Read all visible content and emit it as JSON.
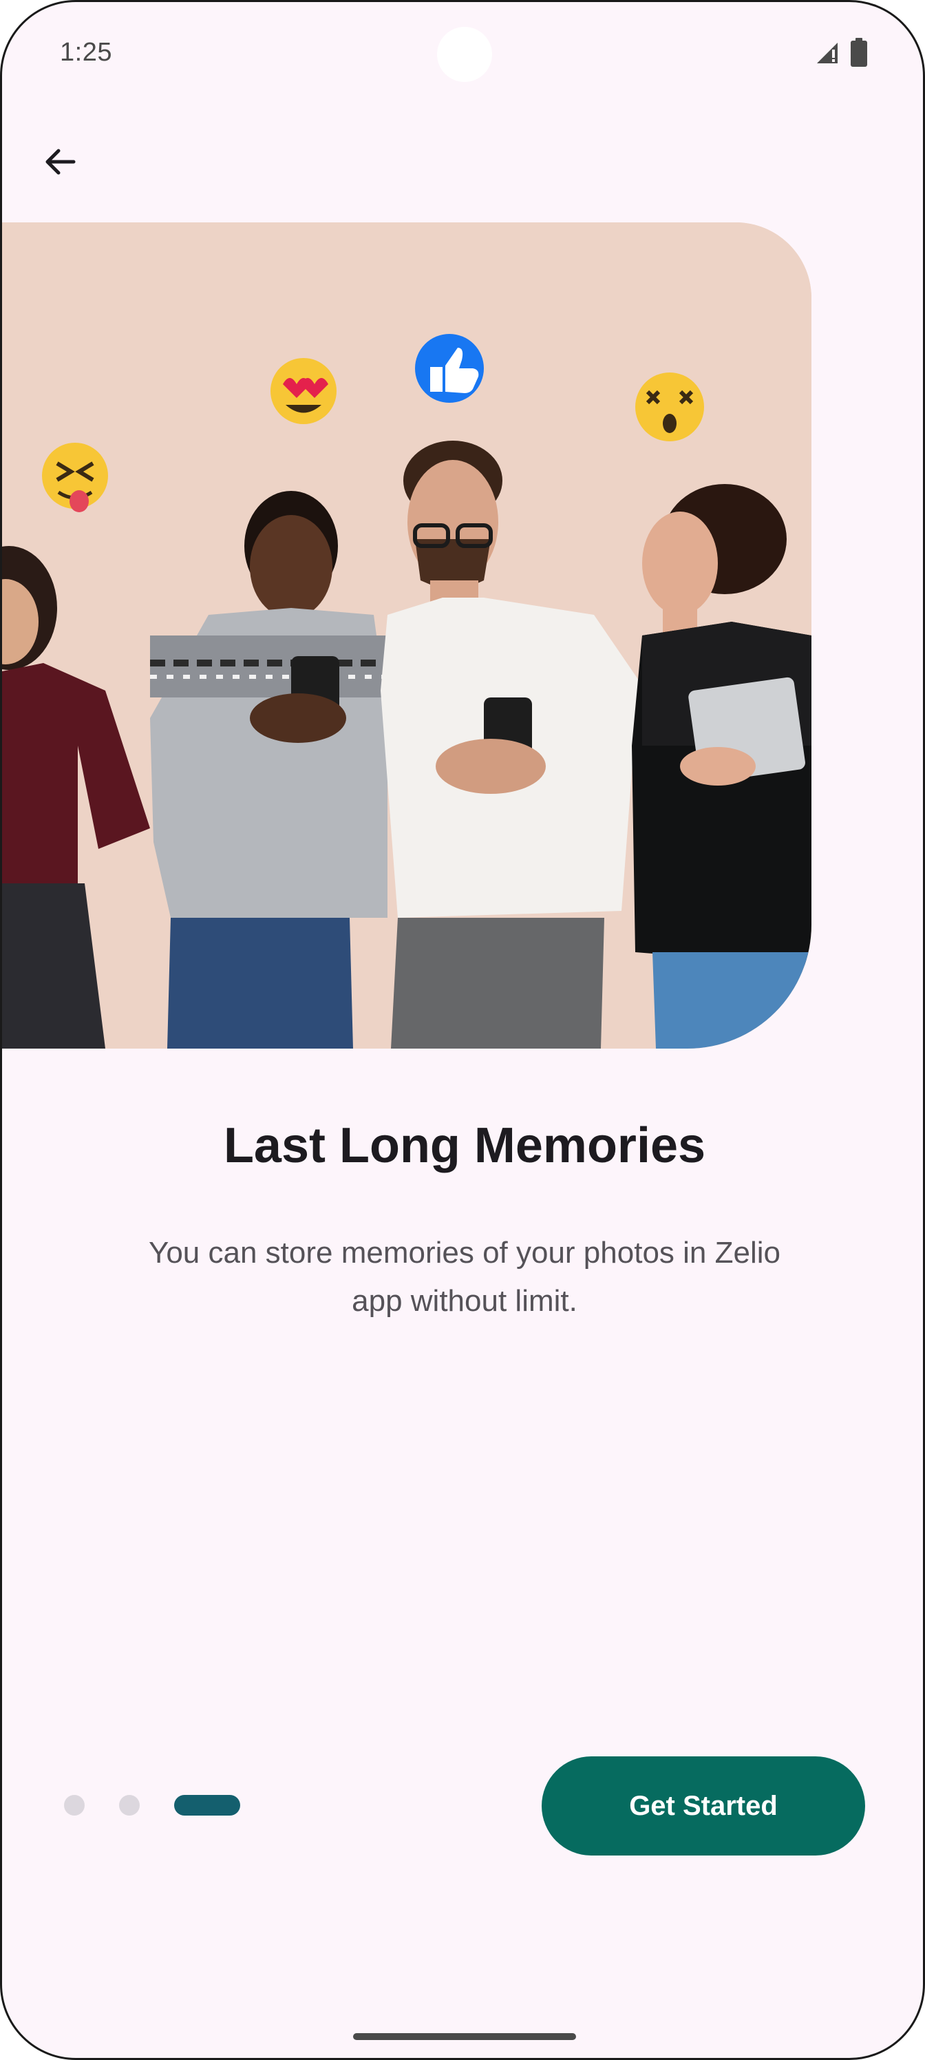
{
  "status_bar": {
    "time": "1:25",
    "icons": [
      "signal-icon",
      "battery-icon"
    ]
  },
  "nav": {
    "back_icon": "arrow-left-icon"
  },
  "hero": {
    "emojis": [
      "squinting-tongue-emoji",
      "heart-eyes-emoji",
      "thumbs-up-emoji",
      "astonished-emoji"
    ]
  },
  "onboarding": {
    "title": "Last Long Memories",
    "description": "You can store memories of your photos in Zelio app without limit.",
    "page_count": 3,
    "current_page": 3
  },
  "cta": {
    "label": "Get Started"
  },
  "colors": {
    "background": "#fdf5fb",
    "primary": "#066b5f",
    "indicator_active": "#145f6e",
    "indicator_inactive": "#dcd7de",
    "hero_bg": "#edd3c6"
  }
}
